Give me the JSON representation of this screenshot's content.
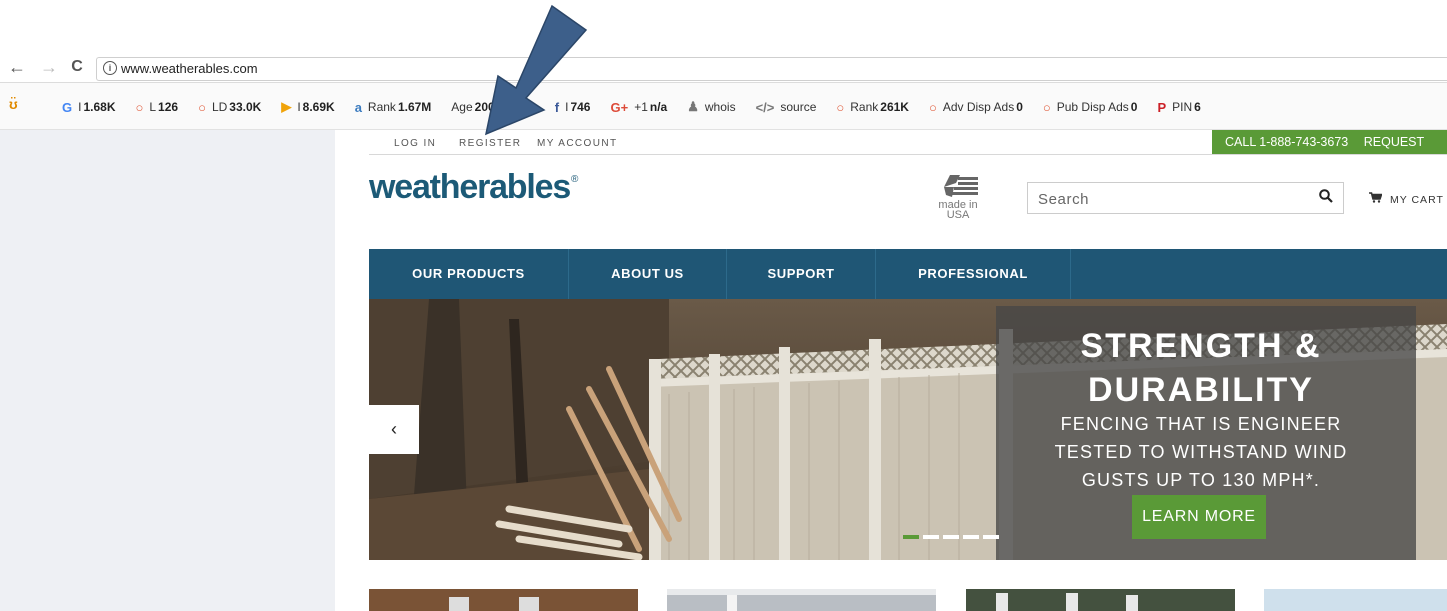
{
  "browser": {
    "back_glyph": "←",
    "forward_glyph": "→",
    "reload_glyph": "C",
    "info_glyph": "i",
    "url": "www.weatherables.com"
  },
  "seo_toolbar": {
    "items": [
      {
        "icon": "G",
        "label": "I",
        "value": "1.68K",
        "color": "#4285f4"
      },
      {
        "icon": "○",
        "label": "L",
        "value": "126",
        "color": "#e05a3a"
      },
      {
        "icon": "○",
        "label": "LD",
        "value": "33.0K",
        "color": "#e05a3a"
      },
      {
        "icon": "▶",
        "label": "I",
        "value": "8.69K",
        "color": "#f0a30a"
      },
      {
        "icon": "a",
        "label": "Rank",
        "value": "1.67M",
        "color": "#3b7bbf"
      },
      {
        "icon": "",
        "label": "Age",
        "value": "2001|12|02",
        "color": "#555555"
      },
      {
        "icon": "f",
        "label": "I",
        "value": "746",
        "color": "#3b5998"
      },
      {
        "icon": "G+",
        "label": "+1",
        "value": "n/a",
        "color": "#dd4b39"
      },
      {
        "icon": "♟",
        "label": "whois",
        "value": "",
        "color": "#777777"
      },
      {
        "icon": "</>",
        "label": "source",
        "value": "",
        "color": "#777777"
      },
      {
        "icon": "○",
        "label": "Rank",
        "value": "261K",
        "color": "#e05a3a"
      },
      {
        "icon": "○",
        "label": "Adv Disp Ads",
        "value": "0",
        "color": "#e05a3a"
      },
      {
        "icon": "○",
        "label": "Pub Disp Ads",
        "value": "0",
        "color": "#e05a3a"
      },
      {
        "icon": "P",
        "label": "PIN",
        "value": "6",
        "color": "#cb2027"
      }
    ]
  },
  "header": {
    "links": [
      "LOG IN",
      "REGISTER",
      "MY ACCOUNT"
    ],
    "call_text": "CALL 1-888-743-3673",
    "request_text": "REQUEST",
    "logo_text": "weatherables",
    "logo_mark": "®",
    "made_in_usa": "made in USA",
    "search_placeholder": "Search",
    "cart_label": "MY CART"
  },
  "nav": {
    "items": [
      "OUR PRODUCTS",
      "ABOUT US",
      "SUPPORT",
      "PROFESSIONAL"
    ]
  },
  "hero": {
    "prev_glyph": "‹",
    "headline_line1": "STRENGTH &",
    "headline_line2": "DURABILITY",
    "sub_line1": "FENCING THAT IS ENGINEER",
    "sub_line2": "TESTED TO WITHSTAND WIND",
    "sub_line3": "GUSTS UP TO 130 MPH*.",
    "button_label": "LEARN MORE",
    "slide_count": 5,
    "active_slide": 1
  },
  "colors": {
    "brand_blue": "#1f5675",
    "brand_green": "#5a9a37",
    "annotation_arrow": "#3d5f8a"
  }
}
